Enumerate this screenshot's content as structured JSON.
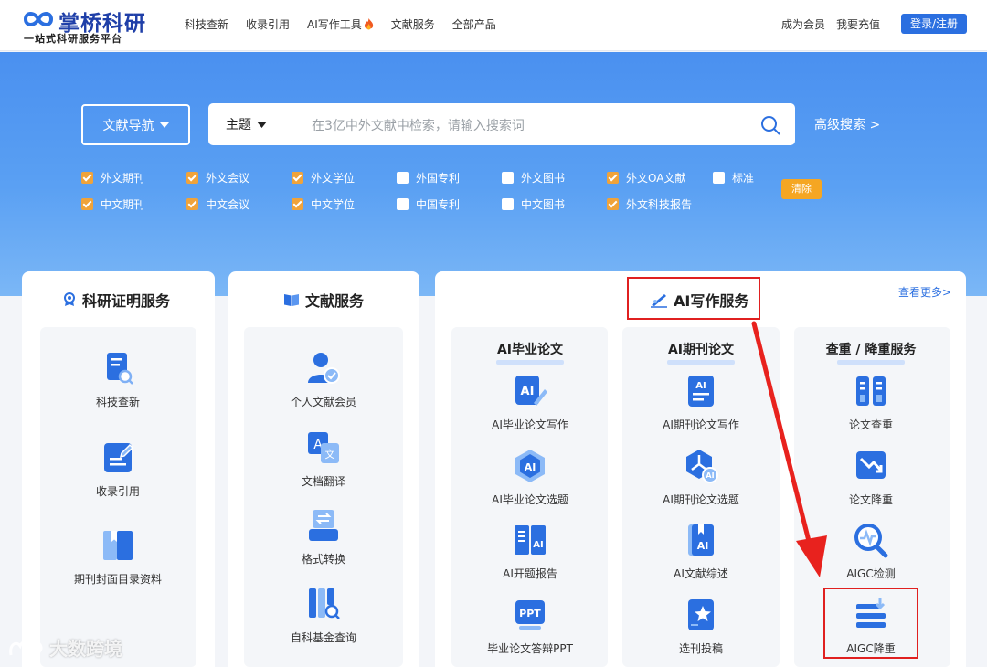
{
  "header": {
    "logo_name": "掌桥科研",
    "logo_slogan": "一站式科研服务平台",
    "nav": [
      "科技查新",
      "收录引用",
      "AI写作工具",
      "文献服务",
      "全部产品"
    ],
    "right_links": [
      "成为会员",
      "我要充值"
    ],
    "login_label": "登录/注册"
  },
  "search": {
    "nav_select": "文献导航",
    "scope": "主题",
    "placeholder": "在3亿中外文献中检索，请输入搜索词",
    "advanced": "高级搜索 >",
    "clear": "清除",
    "filters_row1": [
      {
        "label": "外文期刊",
        "checked": true
      },
      {
        "label": "外文会议",
        "checked": true
      },
      {
        "label": "外文学位",
        "checked": true
      },
      {
        "label": "外国专利",
        "checked": false
      },
      {
        "label": "外文图书",
        "checked": false
      },
      {
        "label": "外文OA文献",
        "checked": true
      },
      {
        "label": "标准",
        "checked": false
      }
    ],
    "filters_row2": [
      {
        "label": "中文期刊",
        "checked": true
      },
      {
        "label": "中文会议",
        "checked": true
      },
      {
        "label": "中文学位",
        "checked": true
      },
      {
        "label": "中国专利",
        "checked": false
      },
      {
        "label": "中文图书",
        "checked": false
      },
      {
        "label": "外文科技报告",
        "checked": true
      }
    ]
  },
  "cards": {
    "research": {
      "title": "科研证明服务",
      "items": [
        "科技查新",
        "收录引用",
        "期刊封面目录资料"
      ]
    },
    "literature": {
      "title": "文献服务",
      "items": [
        "个人文献会员",
        "文档翻译",
        "格式转换",
        "自科基金查询"
      ]
    },
    "ai": {
      "title": "AI写作服务",
      "more": "查看更多>",
      "columns": [
        {
          "title": "AI毕业论文",
          "items": [
            "AI毕业论文写作",
            "AI毕业论文选题",
            "AI开题报告",
            "毕业论文答辩PPT"
          ]
        },
        {
          "title": "AI期刊论文",
          "items": [
            "AI期刊论文写作",
            "AI期刊论文选题",
            "AI文献综述",
            "选刊投稿"
          ]
        },
        {
          "title": "查重 / 降重服务",
          "items": [
            "论文查重",
            "论文降重",
            "AIGC检测",
            "AIGC降重"
          ]
        }
      ]
    }
  },
  "watermark": "大数跨境",
  "colors": {
    "brand_blue": "#2b6fe0",
    "accent_orange": "#f0a33a",
    "highlight_red": "#e02020"
  }
}
